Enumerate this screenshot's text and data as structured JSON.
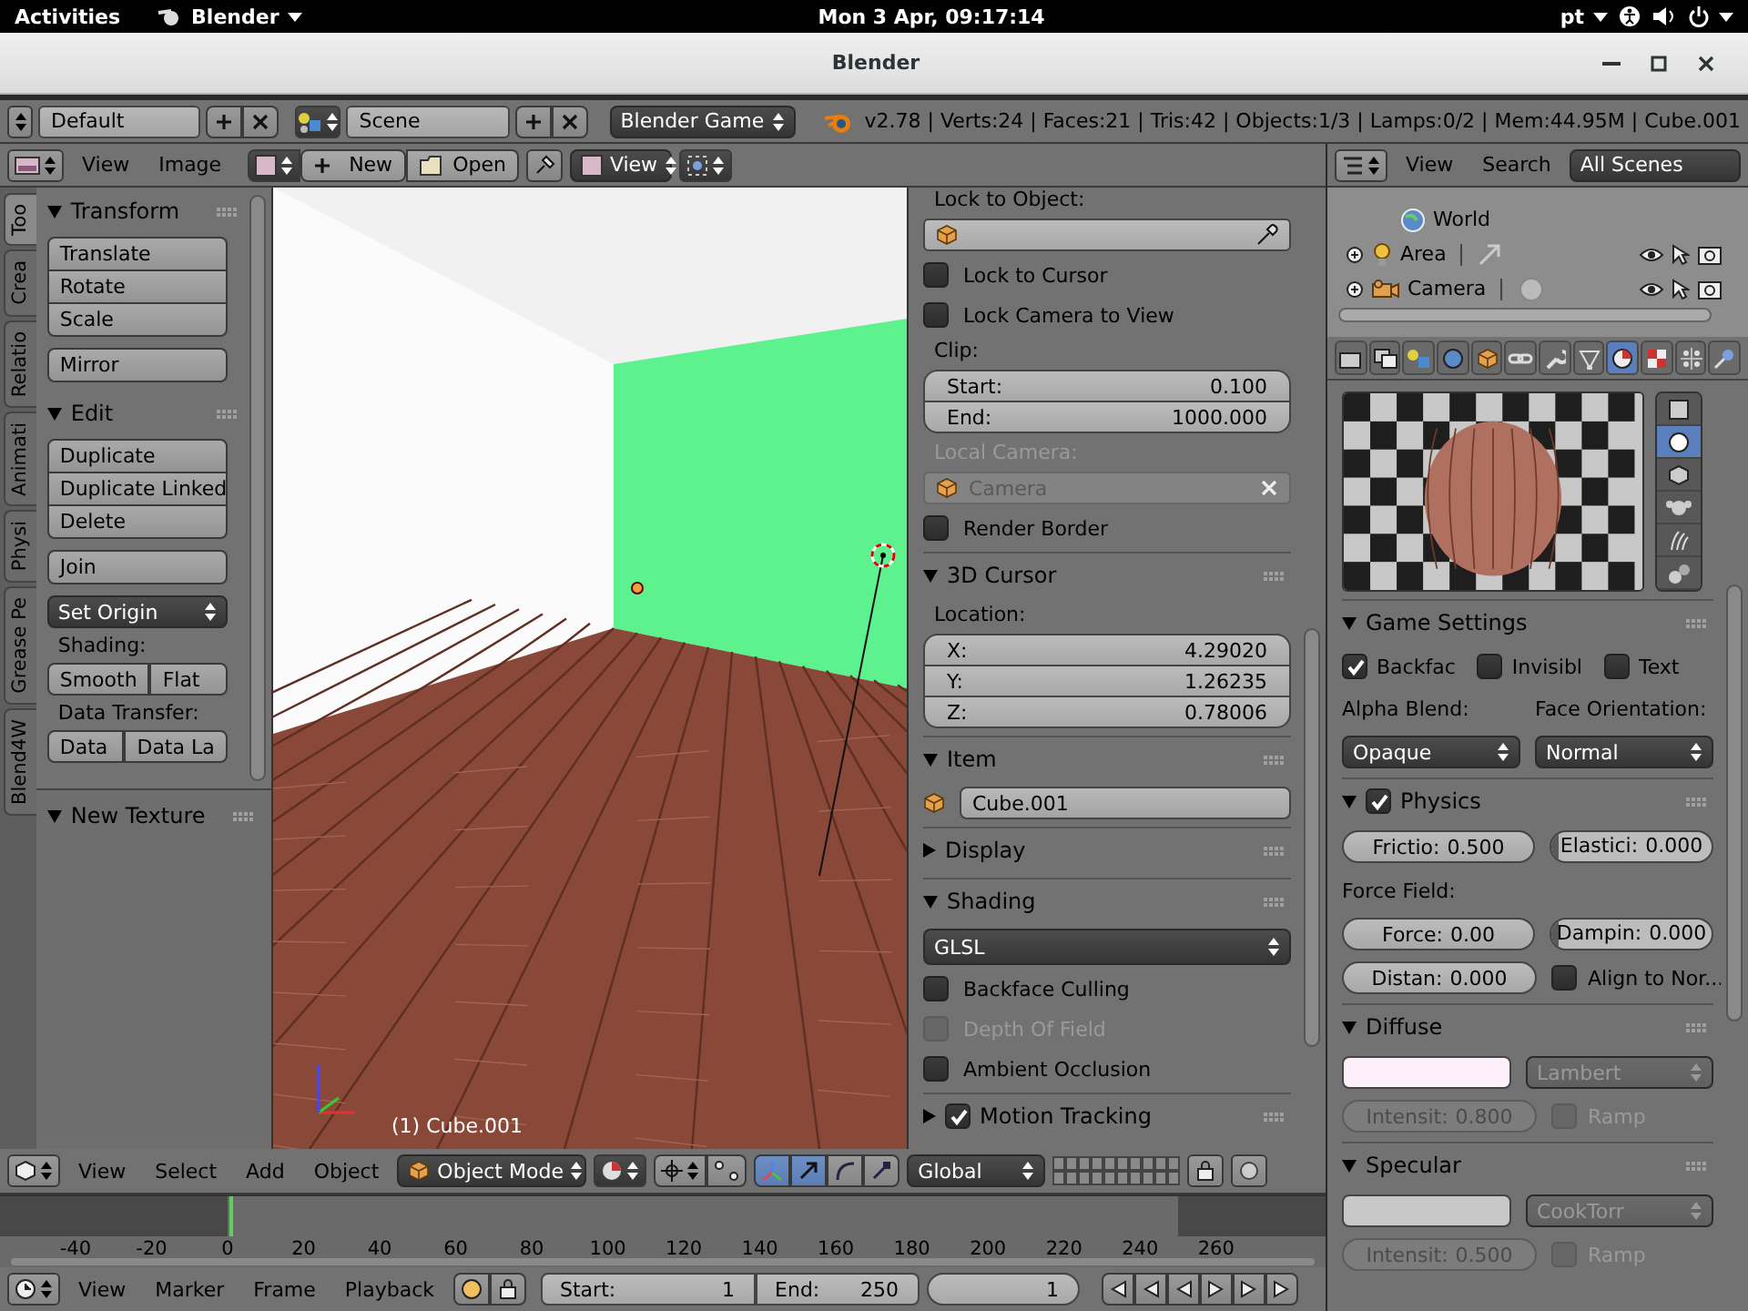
{
  "top_bar": {
    "activities": "Activities",
    "app_menu": "Blender",
    "clock": "Mon  3 Apr, 09:17:14",
    "language": "pt"
  },
  "window": {
    "title": "Blender"
  },
  "info_header": {
    "layout": "Default",
    "scene": "Scene",
    "engine": "Blender Game",
    "stats": "v2.78 | Verts:24 | Faces:21 | Tris:42 | Objects:1/3 | Lamps:0/2 | Mem:44.95M | Cube.001"
  },
  "image_header": {
    "menus": [
      "View",
      "Image"
    ],
    "new_button": "New",
    "open_button": "Open",
    "view_menu": "View"
  },
  "outliner": {
    "menus": [
      "View",
      "Search"
    ],
    "filter": "All Scenes",
    "items": [
      {
        "kind": "world",
        "label": "World"
      },
      {
        "kind": "lamp",
        "label": "Area"
      },
      {
        "kind": "camera",
        "label": "Camera"
      }
    ]
  },
  "tool_shelf": {
    "tabs": [
      {
        "label": "Too",
        "selected": true
      },
      {
        "label": "Crea",
        "selected": false
      },
      {
        "label": "Relatio",
        "selected": false
      },
      {
        "label": "Animati",
        "selected": false
      },
      {
        "label": "Physi",
        "selected": false
      },
      {
        "label": "Grease Pe",
        "selected": false
      },
      {
        "label": "Blend4W",
        "selected": false
      }
    ],
    "panels": [
      {
        "title": "Transform",
        "expanded": true,
        "rows": [
          {
            "kind": "stack",
            "items": [
              "Translate",
              "Rotate",
              "Scale"
            ]
          },
          {
            "kind": "stack",
            "items": [
              "Mirror"
            ]
          }
        ]
      },
      {
        "title": "Edit",
        "expanded": true,
        "rows": [
          {
            "kind": "stack",
            "items": [
              "Duplicate",
              "Duplicate Linked",
              "Delete"
            ]
          },
          {
            "kind": "stack",
            "items": [
              "Join"
            ]
          },
          {
            "kind": "dropdown",
            "value": "Set Origin"
          },
          {
            "kind": "label",
            "text": "Shading:"
          },
          {
            "kind": "pair",
            "items": [
              "Smooth",
              "Flat"
            ]
          },
          {
            "kind": "label",
            "text": "Data Transfer:"
          },
          {
            "kind": "pair",
            "items": [
              "Data",
              "Data La"
            ]
          }
        ]
      }
    ],
    "lower_panel": {
      "title": "New Texture",
      "expanded": true
    }
  },
  "viewport": {
    "overlay_text": "(1) Cube.001"
  },
  "n_panel": {
    "rows": [
      {
        "kind": "label",
        "text": "Lock to Object:",
        "disabled": false
      },
      {
        "kind": "object_picker"
      },
      {
        "kind": "checkbox",
        "label": "Lock to Cursor",
        "checked": false,
        "disabled": false
      },
      {
        "kind": "checkbox",
        "label": "Lock Camera to View",
        "checked": false,
        "disabled": false
      },
      {
        "kind": "label",
        "text": "Clip:",
        "disabled": false
      },
      {
        "kind": "numbers",
        "items": [
          {
            "label": "Start:",
            "value": "0.100"
          },
          {
            "label": "End:",
            "value": "1000.000"
          }
        ]
      },
      {
        "kind": "label",
        "text": "Local Camera:",
        "disabled": true
      },
      {
        "kind": "object_field",
        "value": "Camera",
        "disabled": true
      },
      {
        "kind": "checkbox",
        "label": "Render Border",
        "checked": false,
        "disabled": false
      }
    ],
    "sections": [
      {
        "title": "3D Cursor",
        "expanded": true,
        "rows": [
          {
            "kind": "label",
            "text": "Location:",
            "disabled": false
          },
          {
            "kind": "numbers",
            "items": [
              {
                "label": "X:",
                "value": "4.29020"
              },
              {
                "label": "Y:",
                "value": "1.26235"
              },
              {
                "label": "Z:",
                "value": "0.78006"
              }
            ]
          }
        ]
      },
      {
        "title": "Item",
        "expanded": true,
        "rows": [
          {
            "kind": "name_field",
            "value": "Cube.001"
          }
        ]
      },
      {
        "title": "Display",
        "expanded": false
      },
      {
        "title": "Shading",
        "expanded": true,
        "rows": [
          {
            "kind": "dropdown",
            "value": "GLSL"
          },
          {
            "kind": "checkbox",
            "label": "Backface Culling",
            "checked": false,
            "disabled": false
          },
          {
            "kind": "checkbox",
            "label": "Depth Of Field",
            "checked": false,
            "disabled": true
          },
          {
            "kind": "checkbox",
            "label": "Ambient Occlusion",
            "checked": false,
            "disabled": false
          }
        ]
      },
      {
        "title": "Motion Tracking",
        "expanded": false,
        "checked": true
      }
    ]
  },
  "header_3d": {
    "menus": [
      "View",
      "Select",
      "Add",
      "Object"
    ],
    "mode": "Object Mode",
    "orientation": "Global",
    "manipulators": [
      {
        "kind": "toggle",
        "selected": true
      },
      {
        "kind": "translate",
        "selected": true
      },
      {
        "kind": "rotate",
        "selected": false
      },
      {
        "kind": "scale",
        "selected": false
      }
    ]
  },
  "timeline": {
    "ticks": [
      "-40",
      "-20",
      "0",
      "20",
      "40",
      "60",
      "80",
      "100",
      "120",
      "140",
      "160",
      "180",
      "200",
      "220",
      "240",
      "260"
    ],
    "menus": [
      "View",
      "Marker",
      "Frame",
      "Playback"
    ],
    "start": {
      "label": "Start:",
      "value": "1"
    },
    "end": {
      "label": "End:",
      "value": "250"
    },
    "current": "1"
  },
  "properties": {
    "context_tabs": [
      {
        "kind": "render",
        "selected": false
      },
      {
        "kind": "layers",
        "selected": false
      },
      {
        "kind": "scene",
        "selected": false
      },
      {
        "kind": "world",
        "selected": false
      },
      {
        "kind": "object",
        "selected": false
      },
      {
        "kind": "constraints",
        "selected": false
      },
      {
        "kind": "modifiers",
        "selected": false
      },
      {
        "kind": "data",
        "selected": false
      },
      {
        "kind": "material",
        "selected": true
      },
      {
        "kind": "texture",
        "selected": false
      },
      {
        "kind": "particles",
        "selected": false
      },
      {
        "kind": "physics",
        "selected": false
      }
    ],
    "preview_shapes": [
      {
        "kind": "plane",
        "selected": false
      },
      {
        "kind": "sphere",
        "selected": true
      },
      {
        "kind": "cube",
        "selected": false
      },
      {
        "kind": "monkey",
        "selected": false
      },
      {
        "kind": "hair",
        "selected": false
      },
      {
        "kind": "spheres",
        "selected": false
      }
    ],
    "sections": [
      {
        "title": "Game Settings",
        "expanded": true,
        "rows": [
          {
            "kind": "checks",
            "items": [
              {
                "label": "Backfac",
                "checked": true
              },
              {
                "label": "Invisibl",
                "checked": false
              },
              {
                "label": "Text",
                "checked": false
              }
            ]
          },
          {
            "kind": "pair",
            "items": [
              {
                "kind": "label",
                "text": "Alpha Blend:"
              },
              {
                "kind": "label",
                "text": "Face Orientation:"
              }
            ]
          },
          {
            "kind": "pair",
            "items": [
              {
                "kind": "dropdown",
                "value": "Opaque",
                "disabled": false
              },
              {
                "kind": "dropdown",
                "value": "Normal",
                "disabled": false
              }
            ]
          }
        ]
      },
      {
        "title": "Physics",
        "expanded": true,
        "checked": true,
        "rows": [
          {
            "kind": "pair",
            "items": [
              {
                "kind": "number",
                "label": "Frictio:",
                "value": "0.500",
                "disabled": false
              },
              {
                "kind": "slider",
                "label": "Elastici:",
                "value": "0.000",
                "level": 0
              }
            ]
          },
          {
            "kind": "pair",
            "items": [
              {
                "kind": "label",
                "text": "Force Field:"
              }
            ]
          },
          {
            "kind": "pair",
            "items": [
              {
                "kind": "number",
                "label": "Force:",
                "value": "0.00",
                "disabled": false
              },
              {
                "kind": "slider",
                "label": "Dampin:",
                "value": "0.000",
                "level": 0
              }
            ]
          },
          {
            "kind": "pair",
            "items": [
              {
                "kind": "number",
                "label": "Distan:",
                "value": "0.000",
                "disabled": false
              },
              {
                "kind": "checkbox",
                "label": "Align to Nor...",
                "checked": false,
                "disabled": false
              }
            ]
          }
        ]
      },
      {
        "title": "Diffuse",
        "expanded": true,
        "rows": [
          {
            "kind": "pair",
            "items": [
              {
                "kind": "swatch",
                "color": "#fdf0fb"
              },
              {
                "kind": "dropdown",
                "value": "Lambert",
                "disabled": true
              }
            ]
          },
          {
            "kind": "pair",
            "items": [
              {
                "kind": "number",
                "label": "Intensit:",
                "value": "0.800",
                "disabled": true
              },
              {
                "kind": "checkbox",
                "label": "Ramp",
                "checked": false,
                "disabled": true
              }
            ]
          }
        ]
      },
      {
        "title": "Specular",
        "expanded": true,
        "rows": [
          {
            "kind": "pair",
            "items": [
              {
                "kind": "swatch",
                "color": "#c8c8c8"
              },
              {
                "kind": "dropdown",
                "value": "CookTorr",
                "disabled": true
              }
            ]
          },
          {
            "kind": "pair",
            "items": [
              {
                "kind": "number",
                "label": "Intensit:",
                "value": "0.500",
                "disabled": true
              },
              {
                "kind": "checkbox",
                "label": "Ramp",
                "checked": false,
                "disabled": true
              }
            ]
          }
        ]
      }
    ]
  }
}
